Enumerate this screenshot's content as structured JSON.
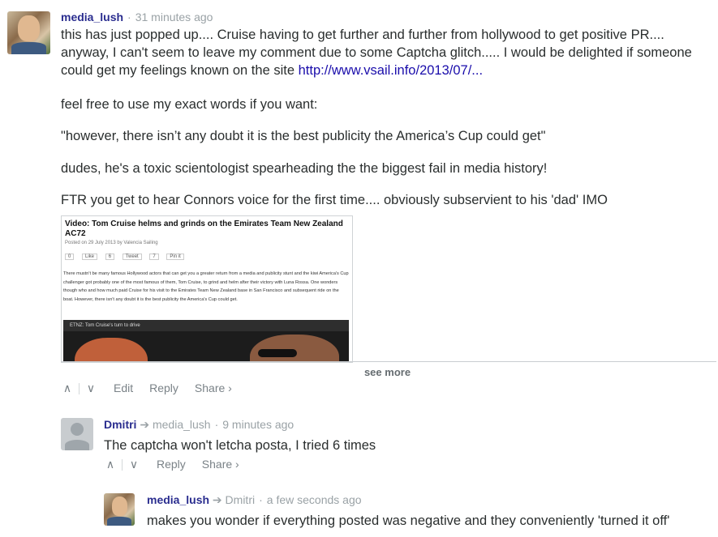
{
  "comments": [
    {
      "author": "media_lush",
      "time": "31 minutes ago",
      "paragraphs": {
        "p1_text": "this has just popped up.... Cruise having to get further and further from hollywood to get positive PR.... anyway, I can't seem to leave my comment due to some Captcha glitch..... I would be delighted if someone could get my feelings known on the site ",
        "p1_link": "http://www.vsail.info/2013/07/...",
        "p2": "feel free to use my exact words if you want:",
        "p3": "\"however, there isn’t any doubt it is the best publicity the America’s Cup could get\"",
        "p4": "dudes, he's a toxic scientologist spearheading the the biggest fail in media history!",
        "p5": "FTR you get to hear Connors voice for the first time.... obviously subservient to his 'dad' IMO"
      },
      "embed": {
        "title": "Video: Tom Cruise helms and grinds on the Emirates Team New Zealand AC72",
        "posted": "Posted on 29 July 2013 by Valencia Sailing",
        "social": [
          "0",
          "Like",
          "6",
          "Tweet",
          "7",
          "Pin it"
        ],
        "body": "There mustn't be many famous Hollywood actors that can get you a greater return from a media and publicity stunt and the kiwi America's Cup challenger got probably one of the most famous of them, Tom Cruise, to grind and helm after their victory with Luna Rossa. One wonders though who and how much paid Cruise for his visit to the Emirates Team New Zealand base in San Francisco and subsequent ride on the boat. However, there isn't any doubt it is the best publicity the America's Cup could get.",
        "video_caption": "ETNZ: Tom Cruise's turn to drive"
      },
      "see_more": "see more",
      "actions": [
        "Edit",
        "Reply",
        "Share ›"
      ]
    },
    {
      "author": "Dmitri",
      "reply_to": "media_lush",
      "time": "9 minutes ago",
      "text": "The captcha won't letcha posta, I tried 6 times",
      "actions": [
        "Reply",
        "Share ›"
      ]
    },
    {
      "author": "media_lush",
      "reply_to": "Dmitri",
      "time": "a few seconds ago",
      "text": "makes you wonder if everything posted was negative and they conveniently 'turned it off'"
    }
  ],
  "icons": {
    "upvote": "∧",
    "downvote": "∨",
    "reply_arrow": "➔"
  },
  "colors": {
    "author": "#2a2d8f",
    "link": "#1a0dab",
    "meta": "#9aa2a6"
  }
}
